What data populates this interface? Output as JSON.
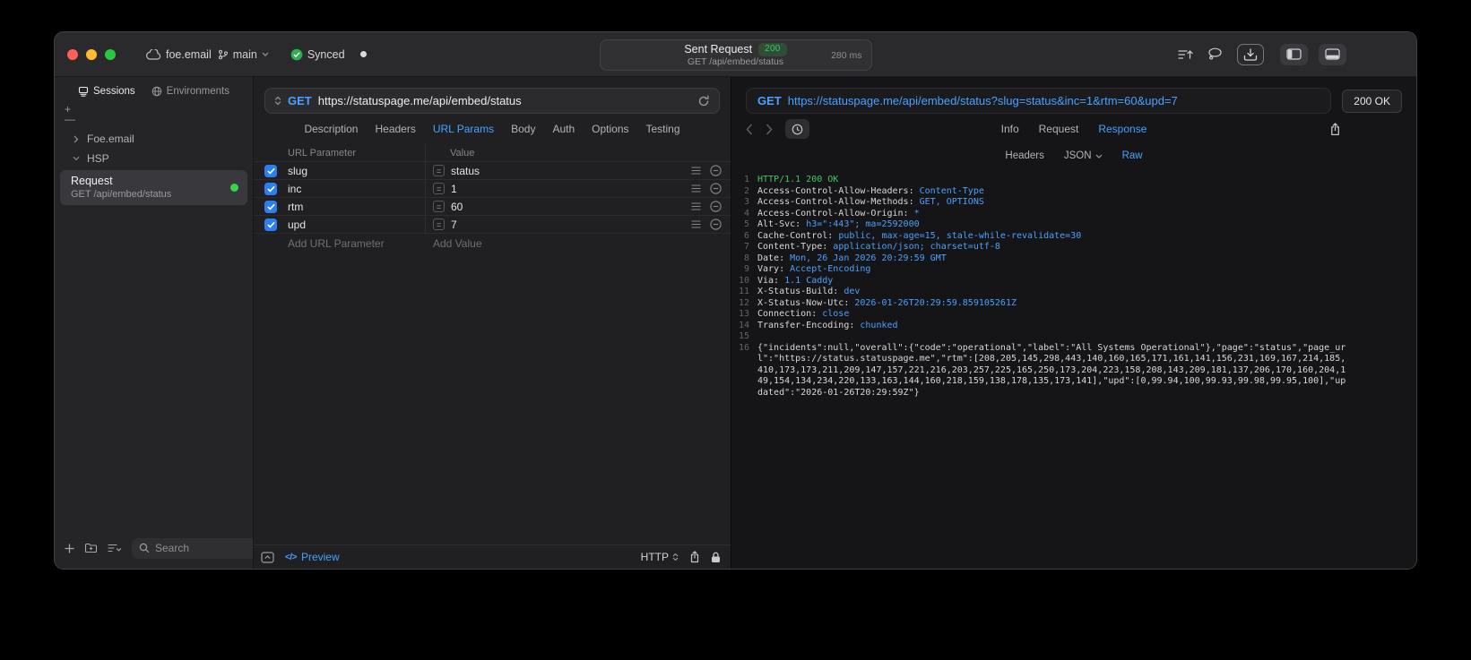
{
  "colors": {
    "accent": "#4BA0FF",
    "green": "#32D74B",
    "badge_green": "#30D158"
  },
  "titlebar": {
    "project": "foe.email",
    "branch": "main",
    "sync_status": "Synced",
    "center": {
      "title": "Sent Request",
      "status_badge": "200",
      "subtitle": "GET /api/embed/status",
      "duration": "280 ms"
    }
  },
  "sidebar": {
    "tabs": [
      {
        "label": "Sessions",
        "active": true
      },
      {
        "label": "Environments",
        "active": false
      }
    ],
    "tree": {
      "group1": "Foe.email",
      "group2": "HSP",
      "request": {
        "title": "Request",
        "subtitle": "GET /api/embed/status"
      }
    },
    "search_placeholder": "Search"
  },
  "request_panel": {
    "method": "GET",
    "url": "https://statuspage.me/api/embed/status",
    "tabs": [
      {
        "label": "Description",
        "active": false
      },
      {
        "label": "Headers",
        "active": false
      },
      {
        "label": "URL Params",
        "active": true
      },
      {
        "label": "Body",
        "active": false
      },
      {
        "label": "Auth",
        "active": false
      },
      {
        "label": "Options",
        "active": false
      },
      {
        "label": "Testing",
        "active": false
      }
    ],
    "table": {
      "col_param": "URL Parameter",
      "col_value": "Value",
      "rows": [
        {
          "name": "slug",
          "value": "status",
          "checked": true
        },
        {
          "name": "inc",
          "value": "1",
          "checked": true
        },
        {
          "name": "rtm",
          "value": "60",
          "checked": true
        },
        {
          "name": "upd",
          "value": "7",
          "checked": true
        }
      ],
      "add_param": "Add URL Parameter",
      "add_value": "Add Value"
    },
    "footer": {
      "preview": "Preview",
      "protocol": "HTTP"
    }
  },
  "response_panel": {
    "request_line": {
      "method": "GET",
      "url": "https://statuspage.me/api/embed/status?slug=status&inc=1&rtm=60&upd=7"
    },
    "status": "200 OK",
    "tabs": [
      {
        "label": "Info",
        "active": false
      },
      {
        "label": "Request",
        "active": false
      },
      {
        "label": "Response",
        "active": true
      }
    ],
    "subtabs": [
      {
        "label": "Headers",
        "active": false
      },
      {
        "label": "JSON",
        "active": false,
        "dropdown": true
      },
      {
        "label": "Raw",
        "active": true
      }
    ],
    "body": [
      {
        "n": 1,
        "segs": [
          {
            "t": "HTTP/1.1 200 OK",
            "c": "s"
          }
        ]
      },
      {
        "n": 2,
        "segs": [
          {
            "t": "Access-Control-Allow-Headers: ",
            "c": "p"
          },
          {
            "t": "Content-Type",
            "c": "v"
          }
        ]
      },
      {
        "n": 3,
        "segs": [
          {
            "t": "Access-Control-Allow-Methods: ",
            "c": "p"
          },
          {
            "t": "GET, OPTIONS",
            "c": "v"
          }
        ]
      },
      {
        "n": 4,
        "segs": [
          {
            "t": "Access-Control-Allow-Origin: ",
            "c": "p"
          },
          {
            "t": "*",
            "c": "v"
          }
        ]
      },
      {
        "n": 5,
        "segs": [
          {
            "t": "Alt-Svc: ",
            "c": "p"
          },
          {
            "t": "h3=\":443\"; ma=2592000",
            "c": "v"
          }
        ]
      },
      {
        "n": 6,
        "segs": [
          {
            "t": "Cache-Control: ",
            "c": "p"
          },
          {
            "t": "public, max-age=15, stale-while-revalidate=30",
            "c": "v"
          }
        ]
      },
      {
        "n": 7,
        "segs": [
          {
            "t": "Content-Type: ",
            "c": "p"
          },
          {
            "t": "application/json; charset=utf-8",
            "c": "v"
          }
        ]
      },
      {
        "n": 8,
        "segs": [
          {
            "t": "Date: ",
            "c": "p"
          },
          {
            "t": "Mon, 26 Jan 2026 20:29:59 GMT",
            "c": "v"
          }
        ]
      },
      {
        "n": 9,
        "segs": [
          {
            "t": "Vary: ",
            "c": "p"
          },
          {
            "t": "Accept-Encoding",
            "c": "v"
          }
        ]
      },
      {
        "n": 10,
        "segs": [
          {
            "t": "Via: ",
            "c": "p"
          },
          {
            "t": "1.1 Caddy",
            "c": "v"
          }
        ]
      },
      {
        "n": 11,
        "segs": [
          {
            "t": "X-Status-Build: ",
            "c": "p"
          },
          {
            "t": "dev",
            "c": "v"
          }
        ]
      },
      {
        "n": 12,
        "segs": [
          {
            "t": "X-Status-Now-Utc: ",
            "c": "p"
          },
          {
            "t": "2026-01-26T20:29:59.859105261Z",
            "c": "v"
          }
        ]
      },
      {
        "n": 13,
        "segs": [
          {
            "t": "Connection: ",
            "c": "p"
          },
          {
            "t": "close",
            "c": "v"
          }
        ]
      },
      {
        "n": 14,
        "segs": [
          {
            "t": "Transfer-Encoding: ",
            "c": "p"
          },
          {
            "t": "chunked",
            "c": "v"
          }
        ]
      },
      {
        "n": 15,
        "segs": []
      },
      {
        "n": 16,
        "segs": [
          {
            "t": "{\"incidents\":null,\"overall\":{\"code\":\"operational\",\"label\":\"All Systems Operational\"},\"page\":\"status\",\"page_url\":\"https://status.statuspage.me\",\"rtm\":[208,205,145,298,443,140,160,165,171,161,141,156,231,169,167,214,185,410,173,173,211,209,147,157,221,216,203,257,225,165,250,173,204,223,158,208,143,209,181,137,206,170,160,204,149,154,134,234,220,133,163,144,160,218,159,138,178,135,173,141],\"upd\":[0,99.94,100,99.93,99.98,99.95,100],\"updated\":\"2026-01-26T20:29:59Z\"}",
            "c": "p"
          }
        ]
      }
    ]
  }
}
